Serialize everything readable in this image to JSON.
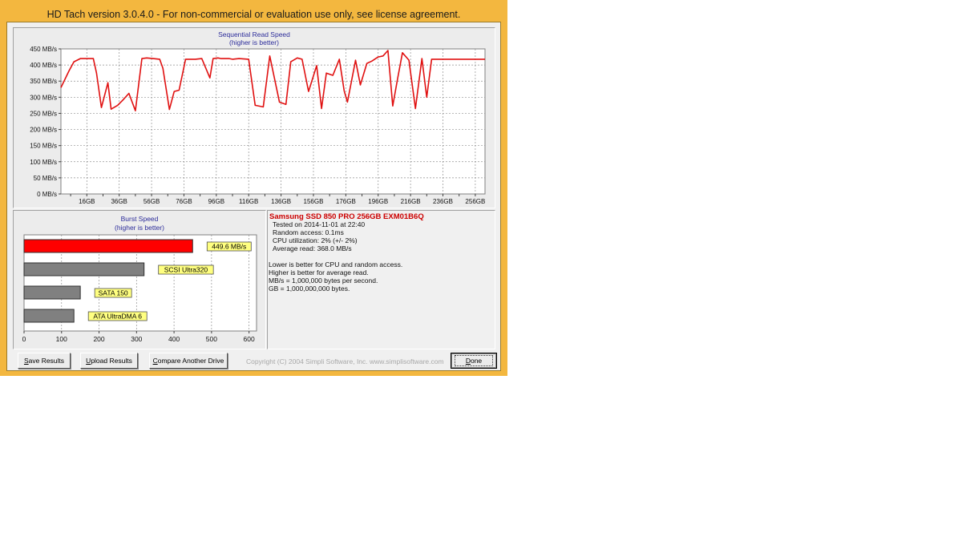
{
  "window": {
    "title": "HD Tach version 3.0.4.0  - For non-commercial or evaluation use only, see license agreement."
  },
  "sequential_chart": {
    "title": "Sequential Read Speed",
    "subtitle": "(higher is better)",
    "y_ticks": [
      "450 MB/s",
      "400 MB/s",
      "350 MB/s",
      "300 MB/s",
      "250 MB/s",
      "200 MB/s",
      "150 MB/s",
      "100 MB/s",
      "50 MB/s",
      "0 MB/s"
    ],
    "x_ticks": [
      "16GB",
      "36GB",
      "56GB",
      "76GB",
      "96GB",
      "116GB",
      "136GB",
      "156GB",
      "176GB",
      "196GB",
      "216GB",
      "236GB",
      "256GB"
    ],
    "line_color": "#e01010"
  },
  "burst_chart": {
    "title": "Burst Speed",
    "subtitle": "(higher is better)",
    "x_ticks": [
      "0",
      "100",
      "200",
      "300",
      "400",
      "500",
      "600"
    ]
  },
  "info": {
    "drive_name": "Samsung SSD 850 PRO 256GB EXM01B6Q",
    "tested_on": "Tested on 2014-11-01 at 22:40",
    "random_access": "Random access: 0.1ms",
    "cpu_utilization": "CPU utilization: 2% (+/- 2%)",
    "average_read": "Average read: 368.0 MB/s",
    "note1": "Lower is better for CPU and random access.",
    "note2": "Higher is better for average read.",
    "note3": "MB/s = 1,000,000 bytes per second.",
    "note4": "GB = 1,000,000,000 bytes."
  },
  "buttons": {
    "save_key": "S",
    "save_rest": "ave Results",
    "upload_key": "U",
    "upload_rest": "pload Results",
    "compare_key": "C",
    "compare_rest": "ompare Another Drive",
    "done_key": "D",
    "done_rest": "one"
  },
  "footer": {
    "copyright": "Copyright (C) 2004 Simpli Software, Inc. www.simplisoftware.com"
  },
  "chart_data": [
    {
      "type": "line",
      "title": "Sequential Read Speed",
      "subtitle": "(higher is better)",
      "ylabel": "",
      "xlabel": "",
      "ylim": [
        0,
        450
      ],
      "xlim": [
        0,
        262
      ],
      "x_unit": "GB",
      "y_unit": "MB/s",
      "grid": true,
      "x": [
        0,
        5,
        8,
        12,
        16,
        20,
        22,
        25,
        29,
        31,
        35,
        38,
        42,
        46,
        50,
        53,
        57,
        61,
        63,
        67,
        70,
        73,
        77,
        80,
        83,
        87,
        92,
        94,
        97,
        99,
        104,
        106,
        110,
        116,
        120,
        125,
        129,
        135,
        139,
        142,
        146,
        149,
        153,
        158,
        161,
        164,
        168,
        172,
        175,
        177,
        182,
        185,
        189,
        192,
        196,
        199,
        202,
        205,
        208,
        211,
        215,
        219,
        223,
        226,
        229,
        233,
        238,
        240,
        243,
        245,
        248,
        252,
        255,
        258,
        262
      ],
      "y": [
        330,
        382,
        410,
        420,
        420,
        420,
        375,
        268,
        345,
        263,
        275,
        290,
        312,
        258,
        420,
        422,
        420,
        418,
        390,
        262,
        318,
        322,
        418,
        418,
        418,
        420,
        360,
        420,
        422,
        420,
        420,
        418,
        420,
        418,
        275,
        270,
        428,
        285,
        278,
        410,
        422,
        418,
        318,
        398,
        265,
        375,
        368,
        418,
        320,
        285,
        415,
        338,
        405,
        412,
        425,
        428,
        445,
        273,
        358,
        438,
        415,
        265,
        420,
        300,
        418,
        418,
        418,
        418,
        418,
        418,
        418,
        418,
        418,
        418,
        418
      ],
      "line_color": "#e01010"
    },
    {
      "type": "bar",
      "title": "Burst Speed",
      "subtitle": "(higher is better)",
      "xlim": [
        0,
        620
      ],
      "orientation": "horizontal",
      "categories": [
        "449.6 MB/s",
        "SCSI Ultra320",
        "SATA 150",
        "ATA UltraDMA 6"
      ],
      "values": [
        449.6,
        320,
        150,
        133
      ],
      "colors": [
        "#ff0000",
        "#808080",
        "#808080",
        "#808080"
      ]
    }
  ]
}
